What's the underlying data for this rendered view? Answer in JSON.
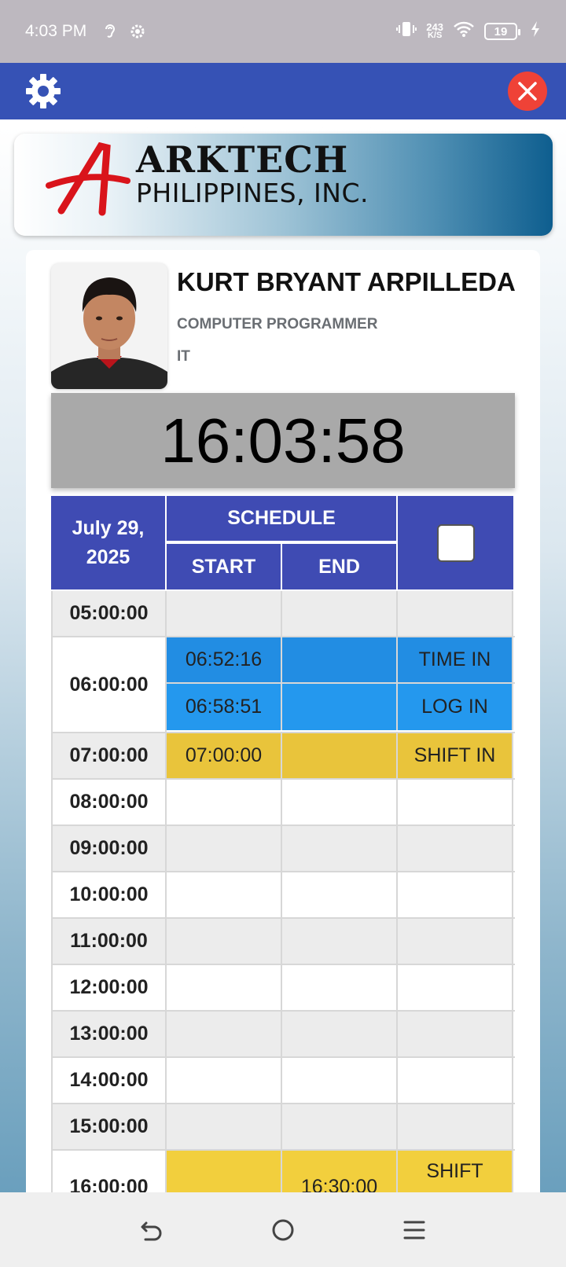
{
  "status_bar": {
    "time": "4:03 PM",
    "net_speed_value": "243",
    "net_speed_unit": "K/S",
    "battery": "19"
  },
  "company": {
    "logo_line1": "ARKTECH",
    "logo_line2": "PHILIPPINES, INC."
  },
  "employee": {
    "name": "KURT BRYANT ARPILLEDA",
    "position": "COMPUTER PROGRAMMER",
    "department": "IT"
  },
  "clock": "16:03:58",
  "schedule": {
    "date": "July 29, 2025",
    "header": "SCHEDULE",
    "start_label": "START",
    "end_label": "END",
    "rows": [
      {
        "time": "05:00:00",
        "start": "",
        "end": "",
        "type": ""
      },
      {
        "time": "06:00:00",
        "entries": [
          {
            "start": "06:52:16",
            "end": "",
            "type": "TIME IN"
          },
          {
            "start": "06:58:51",
            "end": "",
            "type": "LOG IN"
          }
        ]
      },
      {
        "time": "07:00:00",
        "start": "07:00:00",
        "end": "",
        "type": "SHIFT IN"
      },
      {
        "time": "08:00:00",
        "start": "",
        "end": "",
        "type": ""
      },
      {
        "time": "09:00:00",
        "start": "",
        "end": "",
        "type": ""
      },
      {
        "time": "10:00:00",
        "start": "",
        "end": "",
        "type": ""
      },
      {
        "time": "11:00:00",
        "start": "",
        "end": "",
        "type": ""
      },
      {
        "time": "12:00:00",
        "start": "",
        "end": "",
        "type": ""
      },
      {
        "time": "13:00:00",
        "start": "",
        "end": "",
        "type": ""
      },
      {
        "time": "14:00:00",
        "start": "",
        "end": "",
        "type": ""
      },
      {
        "time": "15:00:00",
        "start": "",
        "end": "",
        "type": ""
      },
      {
        "time": "16:00:00",
        "start": "",
        "end": "16:30:00",
        "type": "SHIFT"
      }
    ]
  },
  "colors": {
    "app_bar": "#3652b5",
    "table_header": "#3f4bb3",
    "time_in_blue": "#228de3",
    "shift_yellow": "#e9c43b",
    "close_red": "#ef4237"
  }
}
